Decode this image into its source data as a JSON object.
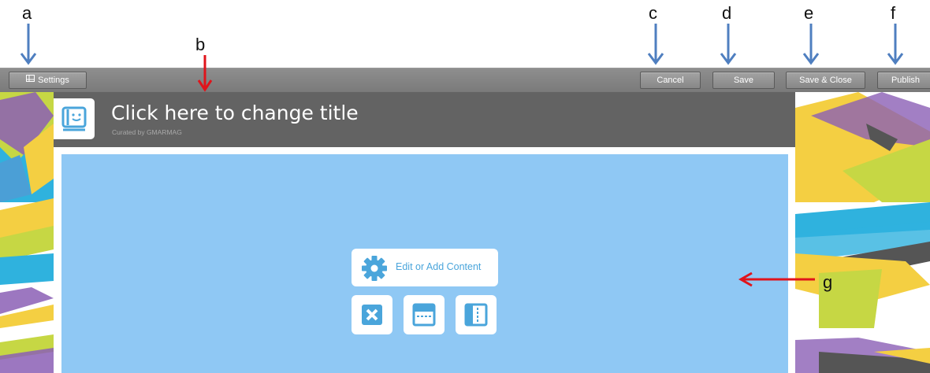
{
  "annotations": {
    "a": "a",
    "b": "b",
    "c": "c",
    "d": "d",
    "e": "e",
    "f": "f",
    "g": "g"
  },
  "toolbar": {
    "settings_label": "Settings",
    "cancel_label": "Cancel",
    "save_label": "Save",
    "save_close_label": "Save & Close",
    "publish_label": "Publish"
  },
  "header": {
    "title": "Click here to change title",
    "subtitle": "Curated by GMARMAG"
  },
  "content": {
    "edit_label": "Edit or Add Content"
  },
  "icons": [
    "settings-icon",
    "logo-icon",
    "gear-icon",
    "close-icon",
    "split-horizontal-icon",
    "split-vertical-icon"
  ],
  "colors": {
    "toolbar": "#808080",
    "header": "#636363",
    "content": "#8fc8f4",
    "accent": "#4aa5db",
    "arrow_blue": "#4f7fc0",
    "arrow_red": "#e0141b"
  }
}
